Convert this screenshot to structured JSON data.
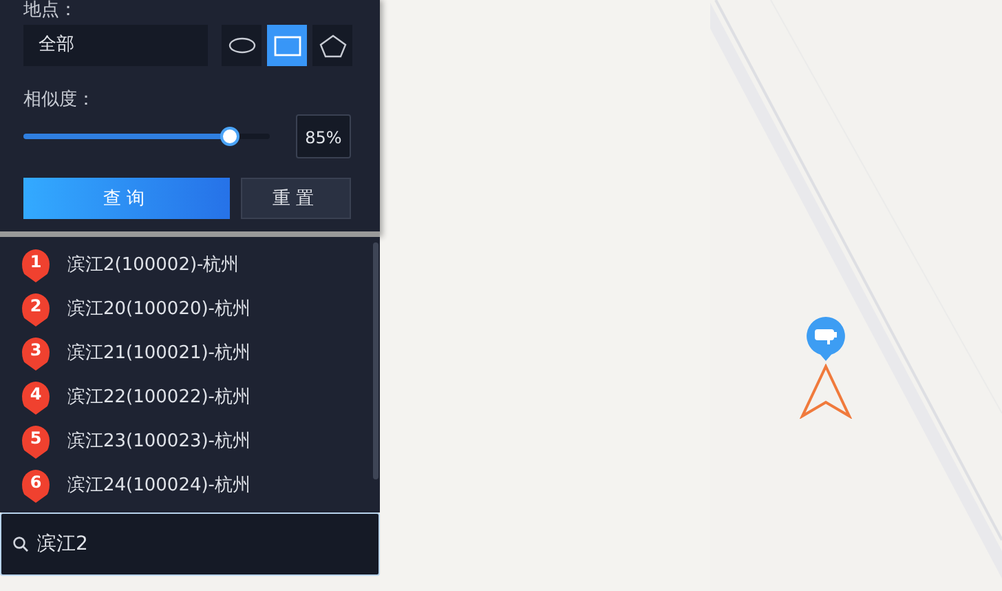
{
  "filter": {
    "location_label": "地点：",
    "location_value": "全部",
    "shapes": [
      {
        "kind": "ellipse",
        "selected": false
      },
      {
        "kind": "rectangle",
        "selected": true
      },
      {
        "kind": "polygon",
        "selected": false
      }
    ],
    "similarity_label": "相似度：",
    "similarity": {
      "level": 0.84,
      "reading": "85%"
    },
    "buttons": [
      {
        "label": "查询",
        "kind": "primary"
      },
      {
        "label": "重置",
        "kind": "secondary"
      }
    ]
  },
  "results": [
    {
      "number": "1",
      "text": "滨江2(100002)-杭州"
    },
    {
      "number": "2",
      "text": "滨江20(100020)-杭州"
    },
    {
      "number": "3",
      "text": "滨江21(100021)-杭州"
    },
    {
      "number": "4",
      "text": "滨江22(100022)-杭州"
    },
    {
      "number": "5",
      "text": "滨江23(100023)-杭州"
    },
    {
      "number": "6",
      "text": "滨江24(100024)-杭州"
    }
  ],
  "search": {
    "value": "滨江2"
  }
}
